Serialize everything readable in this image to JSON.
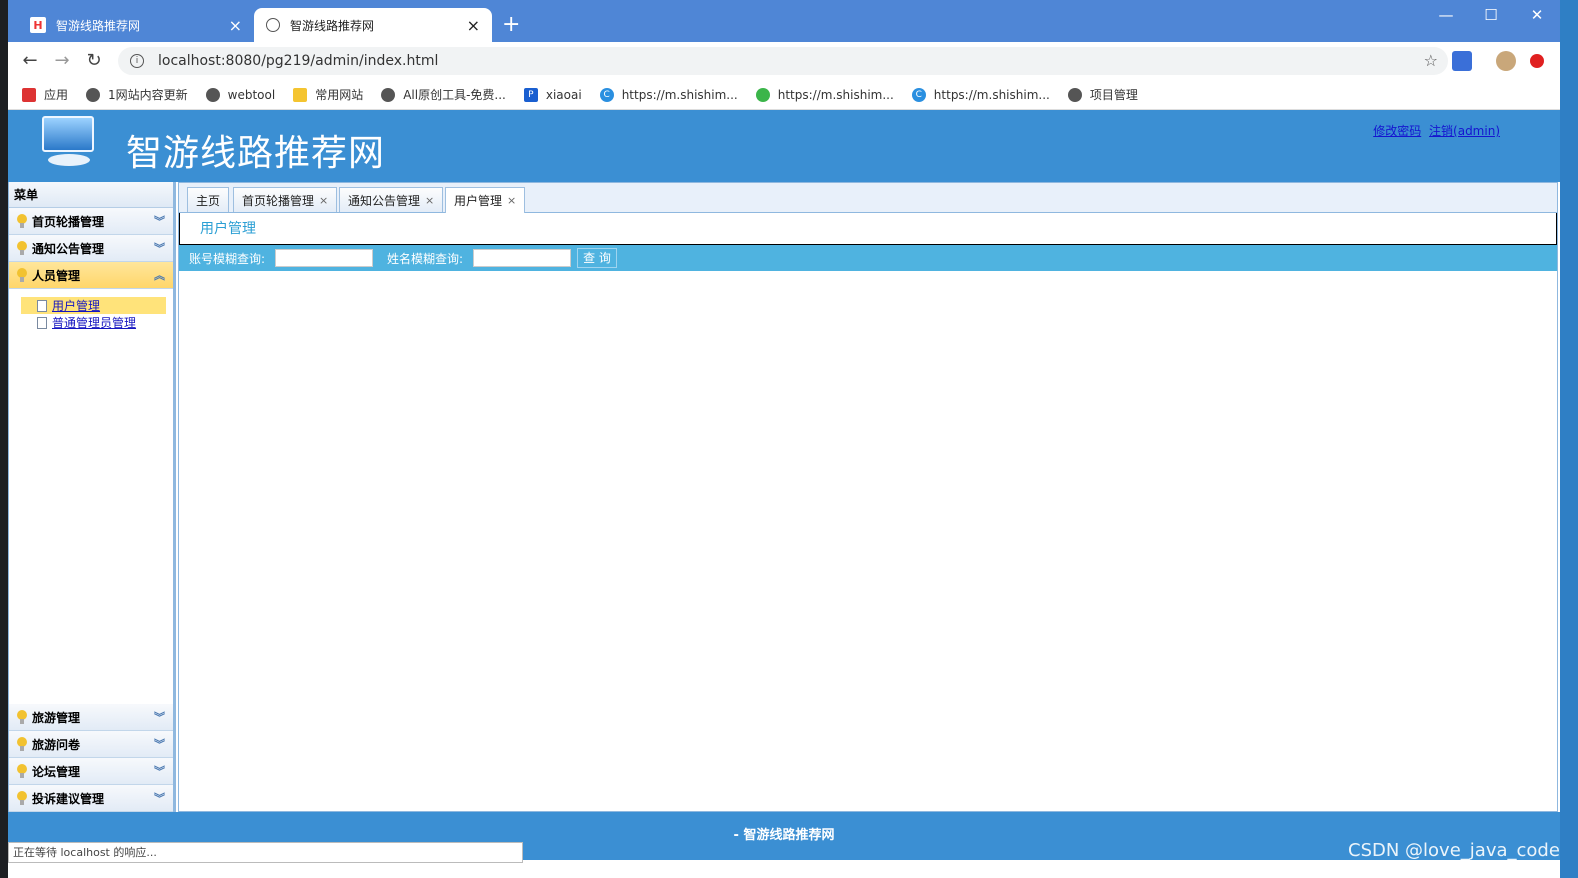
{
  "browser": {
    "tabs": [
      {
        "title": "智游线路推荐网",
        "icon": "h-logo-icon",
        "active": false
      },
      {
        "title": "智游线路推荐网",
        "icon": "globe-icon",
        "active": true
      }
    ],
    "url": "localhost:8080/pg219/admin/index.html",
    "bookmarks": [
      {
        "label": "应用",
        "icon": "apps-grid-icon"
      },
      {
        "label": "1网站内容更新",
        "icon": "globe-icon"
      },
      {
        "label": "webtool",
        "icon": "globe-icon"
      },
      {
        "label": "常用网站",
        "icon": "folder-icon"
      },
      {
        "label": "All原创工具-免费...",
        "icon": "globe-icon"
      },
      {
        "label": "xiaoai",
        "icon": "p-icon"
      },
      {
        "label": "https://m.shishim...",
        "icon": "c-icon"
      },
      {
        "label": "https://m.shishim...",
        "icon": "wechat-icon"
      },
      {
        "label": "https://m.shishim...",
        "icon": "c-icon"
      },
      {
        "label": "项目管理",
        "icon": "globe-icon"
      }
    ]
  },
  "header": {
    "title": "智游线路推荐网",
    "change_password": "修改密码",
    "logout": "注销(admin)"
  },
  "sidebar": {
    "heading": "菜单",
    "top_sections": [
      {
        "label": "首页轮播管理"
      },
      {
        "label": "通知公告管理"
      }
    ],
    "active_section": {
      "label": "人员管理",
      "items": [
        {
          "label": "用户管理",
          "selected": true
        },
        {
          "label": "普通管理员管理",
          "selected": false
        }
      ]
    },
    "bottom_sections": [
      {
        "label": "旅游管理"
      },
      {
        "label": "旅游问卷"
      },
      {
        "label": "论坛管理"
      },
      {
        "label": "投诉建议管理"
      }
    ]
  },
  "content": {
    "tabs": [
      {
        "label": "主页",
        "closable": false
      },
      {
        "label": "首页轮播管理",
        "closable": true
      },
      {
        "label": "通知公告管理",
        "closable": true
      },
      {
        "label": "用户管理",
        "closable": true,
        "active": true
      }
    ],
    "panel_title": "用户管理",
    "search": {
      "account_label": "账号模糊查询:",
      "account_value": "",
      "name_label": "姓名模糊查询:",
      "name_value": "",
      "button": "查 询"
    }
  },
  "footer": {
    "text": "- 智游线路推荐网"
  },
  "status_bar": "正在等待 localhost 的响应...",
  "watermark": "CSDN @love_java_code",
  "colors": {
    "header_blue": "#3b8fd3",
    "search_bar": "#4fb3e0",
    "active_menu": "#ffd66a",
    "browser_tabbar": "#4f86d6"
  }
}
